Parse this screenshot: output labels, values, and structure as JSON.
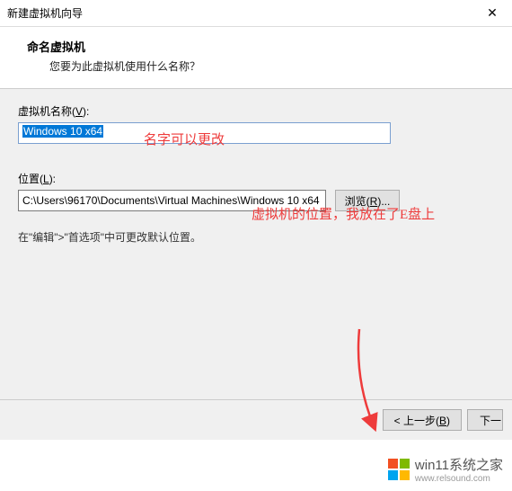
{
  "window": {
    "title": "新建虚拟机向导",
    "close_glyph": "✕"
  },
  "header": {
    "title": "命名虚拟机",
    "subtitle": "您要为此虚拟机使用什么名称？"
  },
  "fields": {
    "name_label": "虚拟机名称(",
    "name_key": "V",
    "name_label_end": "):",
    "name_value": "Windows 10 x64",
    "location_label": "位置(",
    "location_key": "L",
    "location_label_end": "):",
    "location_value": "C:\\Users\\96170\\Documents\\Virtual Machines\\Windows 10 x64",
    "browse_label": "浏览(",
    "browse_key": "R",
    "browse_label_end": ")...",
    "hint": "在\"编辑\">\"首选项\"中可更改默认位置。"
  },
  "annotations": {
    "name_note": "名字可以更改",
    "location_note": "虚拟机的位置，我放在了E盘上"
  },
  "footer": {
    "back_label": "< 上一步(",
    "back_key": "B",
    "back_label_end": ")",
    "next_label": "下一"
  },
  "watermark": {
    "main": "win11系统之家",
    "sub": "www.relsound.com"
  }
}
